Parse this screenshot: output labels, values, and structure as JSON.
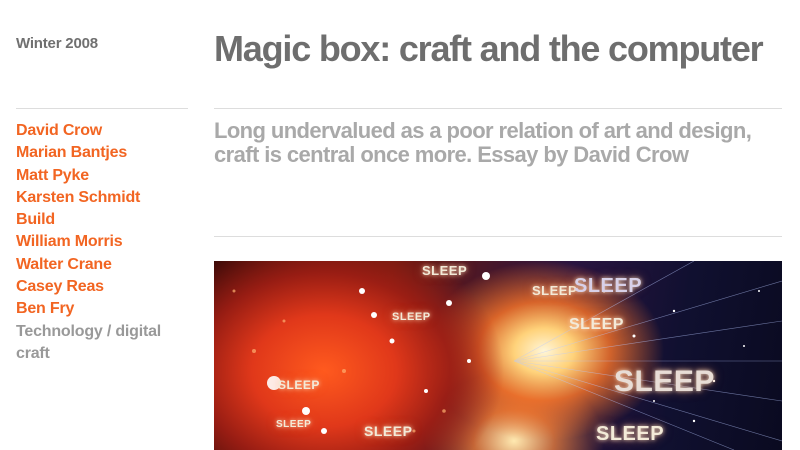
{
  "issue": {
    "season": "Winter 2008"
  },
  "article": {
    "title": "Magic box: craft and the computer",
    "standfirst": "Long undervalued as a poor relation of art and design, craft is central once more. Essay by David Crow"
  },
  "nav": {
    "items": [
      {
        "label": "David Crow",
        "current": false
      },
      {
        "label": "Marian Bantjes",
        "current": false
      },
      {
        "label": "Matt Pyke",
        "current": false
      },
      {
        "label": "Karsten Schmidt",
        "current": false
      },
      {
        "label": "Build",
        "current": false
      },
      {
        "label": "William Morris",
        "current": false
      },
      {
        "label": "Walter Crane",
        "current": false
      },
      {
        "label": "Casey Reas",
        "current": false
      },
      {
        "label": "Ben Fry",
        "current": false
      },
      {
        "label": "Technology / digital craft",
        "current": true
      }
    ]
  },
  "hero": {
    "words": [
      "SLEEP",
      "SLEEP",
      "SLEEP",
      "SLEEP",
      "SLEEP",
      "SLEEP",
      "SLEEP",
      "SLEEP",
      "SLEEP",
      "SLEEP"
    ]
  },
  "colors": {
    "link": "#f26522",
    "current": "#999999",
    "title": "#6e6e6e",
    "standfirst": "#a9a9a9",
    "rule": "#dddddd"
  }
}
